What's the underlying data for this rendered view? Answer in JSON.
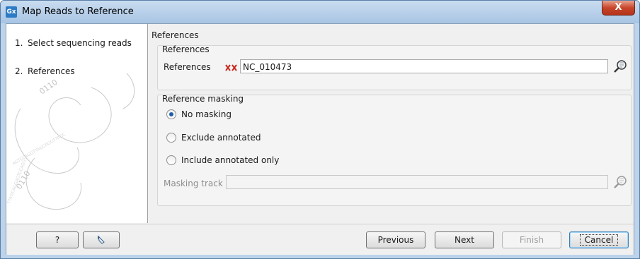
{
  "window": {
    "title": "Map Reads to Reference",
    "app_icon": "Gx",
    "close_glyph": "X"
  },
  "steps": [
    {
      "num": "1.",
      "label": "Select sequencing reads"
    },
    {
      "num": "2.",
      "label": "References"
    }
  ],
  "panel": {
    "title": "References",
    "references_group": {
      "title": "References",
      "field_label": "References",
      "value": "NC_010473"
    },
    "masking_group": {
      "title": "Reference masking",
      "options": [
        {
          "label": "No masking",
          "checked": true
        },
        {
          "label": "Exclude annotated",
          "checked": false
        },
        {
          "label": "Include annotated only",
          "checked": false
        }
      ],
      "track_label": "Masking track",
      "track_value": ""
    }
  },
  "footer": {
    "help_label": "?",
    "previous_label": "Previous",
    "next_label": "Next",
    "finish_label": "Finish",
    "cancel_label": "Cancel"
  },
  "colors": {
    "title_bar": "#bcd3ea",
    "close_button": "#c7462a",
    "radio_checked": "#1f5fa8",
    "reference_icon": "#c8281e"
  }
}
